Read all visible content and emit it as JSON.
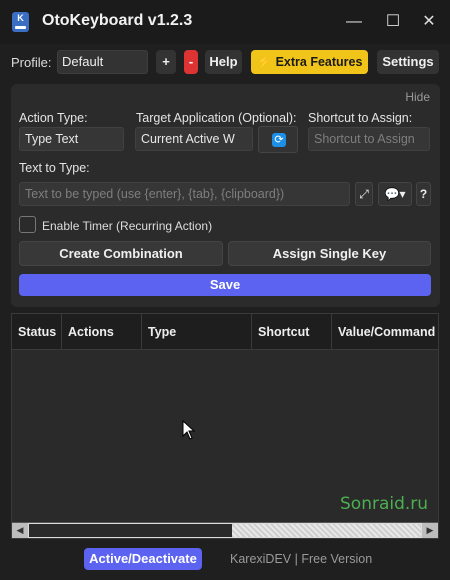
{
  "window": {
    "title": "OtoKeyboard v1.2.3",
    "icon_letter": "K",
    "minimize": "—",
    "maximize": "☐",
    "close": "✕"
  },
  "toolbar": {
    "profile_label": "Profile:",
    "profile_value": "Default",
    "add_label": "+",
    "remove_label": "-",
    "help_label": "Help",
    "extra_label": "⚡ Extra Features",
    "settings_label": "Settings"
  },
  "panel": {
    "hide_label": "Hide",
    "action_type_label": "Action Type:",
    "action_type_value": "Type Text",
    "target_app_label": "Target Application (Optional):",
    "target_app_value": "Current Active W",
    "refresh_icon": "⟳",
    "shortcut_label": "Shortcut to Assign:",
    "shortcut_placeholder": "Shortcut to Assign",
    "text_to_type_label": "Text to Type:",
    "text_placeholder": "Text to be typed (use {enter}, {tab}, {clipboard})",
    "expand_icon": "⤢",
    "chat_icon": "💬▾",
    "question_label": "?",
    "timer_label": "Enable Timer (Recurring Action)",
    "create_combination_label": "Create Combination",
    "assign_single_key_label": "Assign Single Key",
    "save_label": "Save"
  },
  "table": {
    "columns": [
      "Status",
      "Actions",
      "Type",
      "Shortcut",
      "Value/Command"
    ],
    "rows": [],
    "watermark": "Sonraid.ru"
  },
  "footer": {
    "toggle_label": "Active/Deactivate",
    "credit": "KarexiDEV | Free Version"
  },
  "colors": {
    "accent": "#5b63f0",
    "extra": "#f0c419",
    "danger": "#dd3333",
    "watermark": "#4caf50"
  }
}
